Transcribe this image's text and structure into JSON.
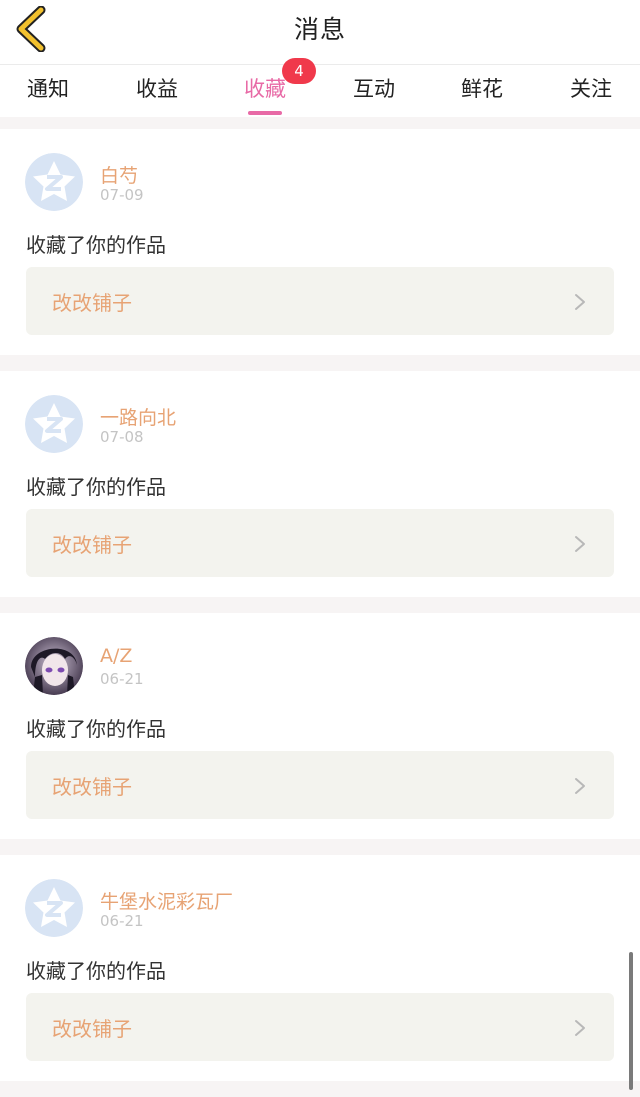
{
  "header": {
    "title": "消息",
    "back_icon": "chevron-left-icon",
    "back_color": "#f2c12e"
  },
  "tabs": [
    {
      "label": "通知"
    },
    {
      "label": "收益"
    },
    {
      "label": "收藏",
      "active": true,
      "badge": "4"
    },
    {
      "label": "互动"
    },
    {
      "label": "鲜花"
    },
    {
      "label": "关注"
    }
  ],
  "colors": {
    "accent": "#e86aa6",
    "badge": "#f0394b",
    "name": "#e7a374",
    "card_link_bg": "#f3f3ee"
  },
  "messages": [
    {
      "name": "白芍",
      "date": "07-09",
      "action": "收藏了你的作品",
      "work": "改改铺子",
      "avatar": "qq-default-avatar-icon"
    },
    {
      "name": "一路向北",
      "date": "07-08",
      "action": "收藏了你的作品",
      "work": "改改铺子",
      "avatar": "qq-default-avatar-icon"
    },
    {
      "name": "A/Z",
      "date": "06-21",
      "action": "收藏了你的作品",
      "work": "改改铺子",
      "avatar": "anime-portrait-avatar"
    },
    {
      "name": "牛堡水泥彩瓦厂",
      "date": "06-21",
      "action": "收藏了你的作品",
      "work": "改改铺子",
      "avatar": "qq-default-avatar-icon"
    }
  ]
}
